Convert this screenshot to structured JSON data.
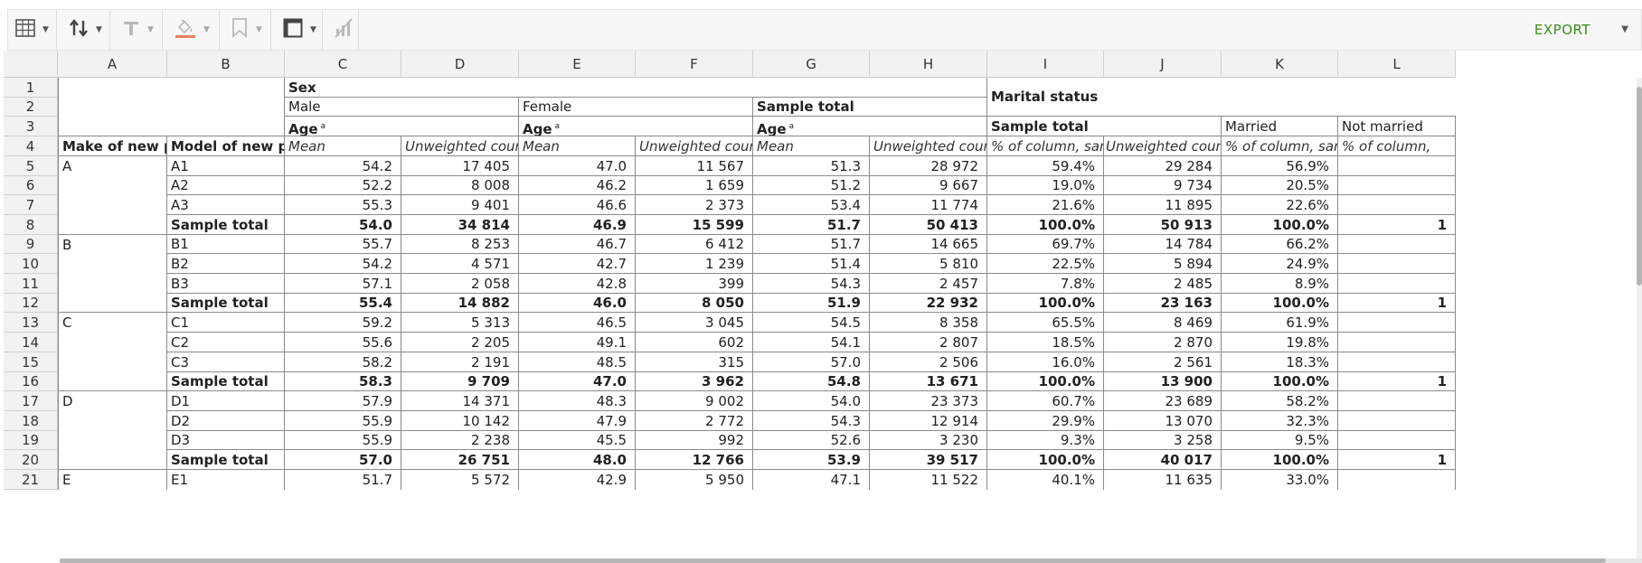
{
  "toolbar": {
    "icons": [
      "table-icon",
      "sort-icon",
      "text-format-icon",
      "fill-color-icon",
      "bookmark-icon",
      "layout-icon",
      "no-chart-icon"
    ],
    "export_label": "EXPORT",
    "accent_color": "#3d8c1e",
    "fill_color_swatch": "#e8825a"
  },
  "columns": [
    "A",
    "B",
    "C",
    "D",
    "E",
    "F",
    "G",
    "H",
    "I",
    "J",
    "K",
    "L"
  ],
  "rows": [
    "1",
    "2",
    "3",
    "4",
    "5",
    "6",
    "7",
    "8",
    "9",
    "10",
    "11",
    "12",
    "13",
    "14",
    "15",
    "16",
    "17",
    "18",
    "19",
    "20",
    "21"
  ],
  "header": {
    "sex": "Sex",
    "marital_status": "Marital status",
    "male": "Male",
    "female": "Female",
    "sample_total": "Sample total",
    "married": "Married",
    "not_married": "Not married",
    "age": "Age",
    "age_note": "a",
    "make": "Make of new phone",
    "model": "Model of new phone",
    "mean": "Mean",
    "unweighted_count": "Unweighted count",
    "pct_column": "% of column, sample",
    "pct_column_trunc": "% of column, "
  },
  "body": [
    {
      "make": "A",
      "model": "A1",
      "cells": [
        "54.2",
        "17 405",
        "47.0",
        "11 567",
        "51.3",
        "28 972",
        "59.4%",
        "29 284",
        "56.9%",
        ""
      ],
      "bold": false
    },
    {
      "make": "",
      "model": "A2",
      "cells": [
        "52.2",
        "8 008",
        "46.2",
        "1 659",
        "51.2",
        "9 667",
        "19.0%",
        "9 734",
        "20.5%",
        ""
      ],
      "bold": false
    },
    {
      "make": "",
      "model": "A3",
      "cells": [
        "55.3",
        "9 401",
        "46.6",
        "2 373",
        "53.4",
        "11 774",
        "21.6%",
        "11 895",
        "22.6%",
        ""
      ],
      "bold": false
    },
    {
      "make": "",
      "model": "Sample total",
      "cells": [
        "54.0",
        "34 814",
        "46.9",
        "15 599",
        "51.7",
        "50 413",
        "100.0%",
        "50 913",
        "100.0%",
        "1"
      ],
      "bold": true
    },
    {
      "make": "B",
      "model": "B1",
      "cells": [
        "55.7",
        "8 253",
        "46.7",
        "6 412",
        "51.7",
        "14 665",
        "69.7%",
        "14 784",
        "66.2%",
        ""
      ],
      "bold": false
    },
    {
      "make": "",
      "model": "B2",
      "cells": [
        "54.2",
        "4 571",
        "42.7",
        "1 239",
        "51.4",
        "5 810",
        "22.5%",
        "5 894",
        "24.9%",
        ""
      ],
      "bold": false
    },
    {
      "make": "",
      "model": "B3",
      "cells": [
        "57.1",
        "2 058",
        "42.8",
        "399",
        "54.3",
        "2 457",
        "7.8%",
        "2 485",
        "8.9%",
        ""
      ],
      "bold": false
    },
    {
      "make": "",
      "model": "Sample total",
      "cells": [
        "55.4",
        "14 882",
        "46.0",
        "8 050",
        "51.9",
        "22 932",
        "100.0%",
        "23 163",
        "100.0%",
        "1"
      ],
      "bold": true
    },
    {
      "make": "C",
      "model": "C1",
      "cells": [
        "59.2",
        "5 313",
        "46.5",
        "3 045",
        "54.5",
        "8 358",
        "65.5%",
        "8 469",
        "61.9%",
        ""
      ],
      "bold": false
    },
    {
      "make": "",
      "model": "C2",
      "cells": [
        "55.6",
        "2 205",
        "49.1",
        "602",
        "54.1",
        "2 807",
        "18.5%",
        "2 870",
        "19.8%",
        ""
      ],
      "bold": false
    },
    {
      "make": "",
      "model": "C3",
      "cells": [
        "58.2",
        "2 191",
        "48.5",
        "315",
        "57.0",
        "2 506",
        "16.0%",
        "2 561",
        "18.3%",
        ""
      ],
      "bold": false
    },
    {
      "make": "",
      "model": "Sample total",
      "cells": [
        "58.3",
        "9 709",
        "47.0",
        "3 962",
        "54.8",
        "13 671",
        "100.0%",
        "13 900",
        "100.0%",
        "1"
      ],
      "bold": true
    },
    {
      "make": "D",
      "model": "D1",
      "cells": [
        "57.9",
        "14 371",
        "48.3",
        "9 002",
        "54.0",
        "23 373",
        "60.7%",
        "23 689",
        "58.2%",
        ""
      ],
      "bold": false
    },
    {
      "make": "",
      "model": "D2",
      "cells": [
        "55.9",
        "10 142",
        "47.9",
        "2 772",
        "54.3",
        "12 914",
        "29.9%",
        "13 070",
        "32.3%",
        ""
      ],
      "bold": false
    },
    {
      "make": "",
      "model": "D3",
      "cells": [
        "55.9",
        "2 238",
        "45.5",
        "992",
        "52.6",
        "3 230",
        "9.3%",
        "3 258",
        "9.5%",
        ""
      ],
      "bold": false
    },
    {
      "make": "",
      "model": "Sample total",
      "cells": [
        "57.0",
        "26 751",
        "48.0",
        "12 766",
        "53.9",
        "39 517",
        "100.0%",
        "40 017",
        "100.0%",
        "1"
      ],
      "bold": true
    },
    {
      "make": "E",
      "model": "E1",
      "cells": [
        "51.7",
        "5 572",
        "42.9",
        "5 950",
        "47.1",
        "11 522",
        "40.1%",
        "11 635",
        "33.0%",
        ""
      ],
      "bold": false
    }
  ]
}
